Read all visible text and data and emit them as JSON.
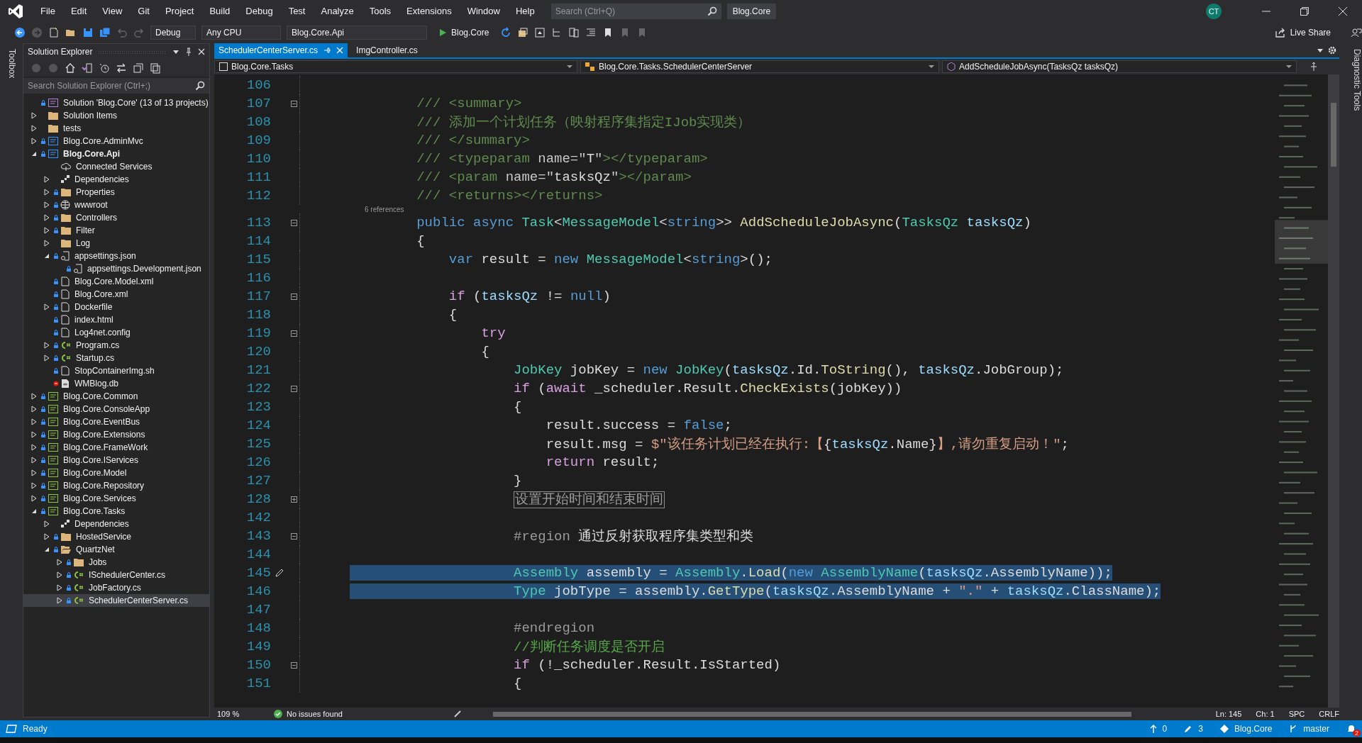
{
  "menu": [
    "File",
    "Edit",
    "View",
    "Git",
    "Project",
    "Build",
    "Debug",
    "Test",
    "Analyze",
    "Tools",
    "Extensions",
    "Window",
    "Help"
  ],
  "search": {
    "placeholder": "Search (Ctrl+Q)"
  },
  "solution_title": "Blog.Core",
  "avatar": "CT",
  "toolbar": {
    "configuration": "Debug",
    "platform": "Any CPU",
    "startup_project": "Blog.Core.Api",
    "run_target": "Blog.Core",
    "live_share": "Live Share"
  },
  "left_strip": "Toolbox",
  "right_strip": "Diagnostic Tools",
  "solution_explorer": {
    "title": "Solution Explorer",
    "search": {
      "placeholder": "Search Solution Explorer (Ctrl+;)"
    },
    "tree": [
      {
        "label": "Solution 'Blog.Core' (13 of 13 projects)",
        "kind": "solution",
        "locked": true,
        "startup": false,
        "selected": false,
        "children": [
          {
            "label": "Solution Items",
            "kind": "folder",
            "expanded": false,
            "locked": false,
            "startup": false,
            "selected": false
          },
          {
            "label": "tests",
            "kind": "folder",
            "expanded": false,
            "locked": false,
            "startup": false,
            "selected": false
          },
          {
            "label": "Blog.Core.AdminMvc",
            "kind": "webproj",
            "expanded": false,
            "locked": true,
            "startup": false,
            "selected": false
          },
          {
            "label": "Blog.Core.Api",
            "kind": "webproj",
            "expanded": true,
            "locked": true,
            "startup": true,
            "selected": false,
            "children": [
              {
                "label": "Connected Services",
                "kind": "cloud",
                "locked": false,
                "startup": false,
                "selected": false
              },
              {
                "label": "Dependencies",
                "kind": "deps",
                "expanded": false,
                "locked": false,
                "startup": false,
                "selected": false
              },
              {
                "label": "Properties",
                "kind": "folder",
                "expanded": false,
                "locked": true,
                "startup": false,
                "selected": false
              },
              {
                "label": "wwwroot",
                "kind": "globe",
                "expanded": false,
                "locked": true,
                "startup": false,
                "selected": false
              },
              {
                "label": "Controllers",
                "kind": "folder",
                "expanded": false,
                "locked": true,
                "startup": false,
                "selected": false
              },
              {
                "label": "Filter",
                "kind": "folder",
                "expanded": false,
                "locked": true,
                "startup": false,
                "selected": false
              },
              {
                "label": "Log",
                "kind": "folder",
                "expanded": false,
                "locked": false,
                "startup": false,
                "selected": false
              },
              {
                "label": "appsettings.json",
                "kind": "json",
                "expanded": true,
                "locked": true,
                "startup": false,
                "selected": false,
                "children": [
                  {
                    "label": "appsettings.Development.json",
                    "kind": "json",
                    "locked": true,
                    "startup": false,
                    "selected": false
                  }
                ]
              },
              {
                "label": "Blog.Core.Model.xml",
                "kind": "file",
                "locked": true,
                "startup": false,
                "selected": false
              },
              {
                "label": "Blog.Core.xml",
                "kind": "file",
                "locked": true,
                "startup": false,
                "selected": false
              },
              {
                "label": "Dockerfile",
                "kind": "file",
                "expanded": false,
                "locked": true,
                "startup": false,
                "selected": false
              },
              {
                "label": "index.html",
                "kind": "file",
                "locked": true,
                "startup": false,
                "selected": false
              },
              {
                "label": "Log4net.config",
                "kind": "file",
                "locked": true,
                "startup": false,
                "selected": false
              },
              {
                "label": "Program.cs",
                "kind": "cs",
                "expanded": false,
                "locked": true,
                "startup": false,
                "selected": false
              },
              {
                "label": "Startup.cs",
                "kind": "cs",
                "expanded": false,
                "locked": true,
                "startup": false,
                "selected": false
              },
              {
                "label": "StopContainerImg.sh",
                "kind": "file",
                "locked": true,
                "startup": false,
                "selected": false
              },
              {
                "label": "WMBlog.db",
                "kind": "db",
                "locked": false,
                "startup": false,
                "selected": false
              }
            ]
          },
          {
            "label": "Blog.Core.Common",
            "kind": "csproj",
            "expanded": false,
            "locked": true,
            "startup": false,
            "selected": false
          },
          {
            "label": "Blog.Core.ConsoleApp",
            "kind": "csproj",
            "expanded": false,
            "locked": true,
            "startup": false,
            "selected": false
          },
          {
            "label": "Blog.Core.EventBus",
            "kind": "csproj",
            "expanded": false,
            "locked": true,
            "startup": false,
            "selected": false
          },
          {
            "label": "Blog.Core.Extensions",
            "kind": "csproj",
            "expanded": false,
            "locked": true,
            "startup": false,
            "selected": false
          },
          {
            "label": "Blog.Core.FrameWork",
            "kind": "csproj",
            "expanded": false,
            "locked": true,
            "startup": false,
            "selected": false
          },
          {
            "label": "Blog.Core.IServices",
            "kind": "csproj",
            "expanded": false,
            "locked": true,
            "startup": false,
            "selected": false
          },
          {
            "label": "Blog.Core.Model",
            "kind": "csproj",
            "expanded": false,
            "locked": true,
            "startup": false,
            "selected": false
          },
          {
            "label": "Blog.Core.Repository",
            "kind": "csproj",
            "expanded": false,
            "locked": true,
            "startup": false,
            "selected": false
          },
          {
            "label": "Blog.Core.Services",
            "kind": "csproj",
            "expanded": false,
            "locked": true,
            "startup": false,
            "selected": false
          },
          {
            "label": "Blog.Core.Tasks",
            "kind": "csproj",
            "expanded": true,
            "locked": true,
            "startup": false,
            "selected": false,
            "children": [
              {
                "label": "Dependencies",
                "kind": "deps",
                "expanded": false,
                "locked": false,
                "startup": false,
                "selected": false
              },
              {
                "label": "HostedService",
                "kind": "folder",
                "expanded": false,
                "locked": true,
                "startup": false,
                "selected": false
              },
              {
                "label": "QuartzNet",
                "kind": "folder",
                "expanded": true,
                "locked": true,
                "startup": false,
                "selected": false,
                "children": [
                  {
                    "label": "Jobs",
                    "kind": "folder",
                    "expanded": false,
                    "locked": true,
                    "startup": false,
                    "selected": false
                  },
                  {
                    "label": "ISchedulerCenter.cs",
                    "kind": "cs",
                    "expanded": false,
                    "locked": true,
                    "startup": false,
                    "selected": false
                  },
                  {
                    "label": "JobFactory.cs",
                    "kind": "cs",
                    "expanded": false,
                    "locked": true,
                    "startup": false,
                    "selected": false
                  },
                  {
                    "label": "SchedulerCenterServer.cs",
                    "kind": "cs",
                    "expanded": false,
                    "locked": true,
                    "startup": false,
                    "selected": true
                  }
                ]
              }
            ]
          }
        ]
      }
    ]
  },
  "tabs": [
    {
      "label": "SchedulerCenterServer.cs",
      "selected": true
    },
    {
      "label": "ImgController.cs",
      "selected": false
    }
  ],
  "navigation": {
    "project": "Blog.Core.Tasks",
    "type": "Blog.Core.Tasks.SchedulerCenterServer",
    "member": "AddScheduleJobAsync(TasksQz tasksQz)"
  },
  "code": [
    {
      "number": "106",
      "selected": false
    },
    {
      "number": "107",
      "expanded": true,
      "selected": false,
      "tokens": [
        {
          "kind": "doc",
          "text": "        /// <summary>"
        }
      ]
    },
    {
      "number": "108",
      "selected": false,
      "tokens": [
        {
          "kind": "doc",
          "text": "        /// 添加一个计划任务（映射程序集指定IJob实现类）"
        }
      ]
    },
    {
      "number": "109",
      "selected": false,
      "tokens": [
        {
          "kind": "doc",
          "text": "        /// </summary>"
        }
      ]
    },
    {
      "number": "110",
      "selected": false,
      "tokens": [
        {
          "kind": "doc",
          "text": "        /// <typeparam "
        },
        {
          "kind": "docattr",
          "text": "name=\""
        },
        {
          "kind": "plain",
          "text": "T"
        },
        {
          "kind": "docattr",
          "text": "\""
        },
        {
          "kind": "doc",
          "text": "></typeparam>"
        }
      ]
    },
    {
      "number": "111",
      "selected": false,
      "tokens": [
        {
          "kind": "doc",
          "text": "        /// <param "
        },
        {
          "kind": "docattr",
          "text": "name=\""
        },
        {
          "kind": "plain",
          "text": "tasksQz"
        },
        {
          "kind": "docattr",
          "text": "\""
        },
        {
          "kind": "doc",
          "text": "></param>"
        }
      ]
    },
    {
      "number": "112",
      "selected": false,
      "tokens": [
        {
          "kind": "doc",
          "text": "        /// <returns></returns>"
        }
      ]
    },
    {
      "number": "113",
      "expanded": true,
      "selected": false,
      "codelens": "6 references",
      "tokens": [
        {
          "kind": "keyword",
          "text": "        public async "
        },
        {
          "kind": "type",
          "text": "Task"
        },
        {
          "kind": "plain",
          "text": "<"
        },
        {
          "kind": "type",
          "text": "MessageModel"
        },
        {
          "kind": "plain",
          "text": "<"
        },
        {
          "kind": "keyword",
          "text": "string"
        },
        {
          "kind": "plain",
          "text": ">> "
        },
        {
          "kind": "method",
          "text": "AddScheduleJobAsync"
        },
        {
          "kind": "plain",
          "text": "("
        },
        {
          "kind": "type",
          "text": "TasksQz"
        },
        {
          "kind": "param",
          "text": " tasksQz"
        },
        {
          "kind": "plain",
          "text": ")"
        }
      ]
    },
    {
      "number": "114",
      "selected": false,
      "tokens": [
        {
          "kind": "plain",
          "text": "        {"
        }
      ]
    },
    {
      "number": "115",
      "selected": false,
      "tokens": [
        {
          "kind": "keyword",
          "text": "            var "
        },
        {
          "kind": "plain",
          "text": "result = "
        },
        {
          "kind": "keyword",
          "text": "new "
        },
        {
          "kind": "type",
          "text": "MessageModel"
        },
        {
          "kind": "plain",
          "text": "<"
        },
        {
          "kind": "keyword",
          "text": "string"
        },
        {
          "kind": "plain",
          "text": ">();"
        }
      ]
    },
    {
      "number": "116",
      "selected": false
    },
    {
      "number": "117",
      "expanded": true,
      "selected": false,
      "tokens": [
        {
          "kind": "control",
          "text": "            if "
        },
        {
          "kind": "plain",
          "text": "("
        },
        {
          "kind": "param",
          "text": "tasksQz"
        },
        {
          "kind": "plain",
          "text": " != "
        },
        {
          "kind": "keyword",
          "text": "null"
        },
        {
          "kind": "plain",
          "text": ")"
        }
      ]
    },
    {
      "number": "118",
      "selected": false,
      "tokens": [
        {
          "kind": "plain",
          "text": "            {"
        }
      ]
    },
    {
      "number": "119",
      "expanded": true,
      "selected": false,
      "tokens": [
        {
          "kind": "control",
          "text": "                try"
        }
      ]
    },
    {
      "number": "120",
      "selected": false,
      "tokens": [
        {
          "kind": "plain",
          "text": "                {"
        }
      ]
    },
    {
      "number": "121",
      "selected": false,
      "tokens": [
        {
          "kind": "type",
          "text": "                    JobKey "
        },
        {
          "kind": "plain",
          "text": "jobKey = "
        },
        {
          "kind": "keyword",
          "text": "new "
        },
        {
          "kind": "type",
          "text": "JobKey"
        },
        {
          "kind": "plain",
          "text": "("
        },
        {
          "kind": "param",
          "text": "tasksQz"
        },
        {
          "kind": "plain",
          "text": ".Id."
        },
        {
          "kind": "method",
          "text": "ToString"
        },
        {
          "kind": "plain",
          "text": "(), "
        },
        {
          "kind": "param",
          "text": "tasksQz"
        },
        {
          "kind": "plain",
          "text": ".JobGroup);"
        }
      ]
    },
    {
      "number": "122",
      "expanded": true,
      "selected": false,
      "tokens": [
        {
          "kind": "control",
          "text": "                    if "
        },
        {
          "kind": "plain",
          "text": "("
        },
        {
          "kind": "control",
          "text": "await "
        },
        {
          "kind": "plain",
          "text": "_scheduler.Result."
        },
        {
          "kind": "method",
          "text": "CheckExists"
        },
        {
          "kind": "plain",
          "text": "(jobKey))"
        }
      ]
    },
    {
      "number": "123",
      "selected": false,
      "tokens": [
        {
          "kind": "plain",
          "text": "                    {"
        }
      ]
    },
    {
      "number": "124",
      "selected": false,
      "tokens": [
        {
          "kind": "plain",
          "text": "                        result.success = "
        },
        {
          "kind": "keyword",
          "text": "false"
        },
        {
          "kind": "plain",
          "text": ";"
        }
      ]
    },
    {
      "number": "125",
      "selected": false,
      "tokens": [
        {
          "kind": "plain",
          "text": "                        result.msg = "
        },
        {
          "kind": "string",
          "text": "$\"该任务计划已经在执行:【"
        },
        {
          "kind": "plain",
          "text": "{"
        },
        {
          "kind": "param",
          "text": "tasksQz"
        },
        {
          "kind": "plain",
          "text": ".Name}"
        },
        {
          "kind": "string",
          "text": "】,请勿重复启动！\""
        },
        {
          "kind": "plain",
          "text": ";"
        }
      ]
    },
    {
      "number": "126",
      "selected": false,
      "tokens": [
        {
          "kind": "control",
          "text": "                        return "
        },
        {
          "kind": "plain",
          "text": "result;"
        }
      ]
    },
    {
      "number": "127",
      "selected": false,
      "tokens": [
        {
          "kind": "plain",
          "text": "                    }"
        }
      ]
    },
    {
      "number": "128",
      "expanded": false,
      "selected": false,
      "tokens": [
        {
          "kind": "collapsed",
          "text": "设置开始时间和结束时间"
        }
      ]
    },
    {
      "number": "142",
      "selected": false
    },
    {
      "number": "143",
      "expanded": true,
      "selected": false,
      "tokens": [
        {
          "kind": "region",
          "text": "                    #region "
        },
        {
          "kind": "plain",
          "text": "通过反射获取程序集类型和类"
        }
      ]
    },
    {
      "number": "144",
      "selected": false
    },
    {
      "number": "145",
      "selected": true,
      "quick_action": true,
      "tokens": [
        {
          "kind": "type",
          "text": "                    Assembly "
        },
        {
          "kind": "plain",
          "text": "assembly = "
        },
        {
          "kind": "type",
          "text": "Assembly"
        },
        {
          "kind": "plain",
          "text": "."
        },
        {
          "kind": "method",
          "text": "Load"
        },
        {
          "kind": "plain",
          "text": "("
        },
        {
          "kind": "keyword",
          "text": "new "
        },
        {
          "kind": "type",
          "text": "AssemblyName"
        },
        {
          "kind": "plain",
          "text": "("
        },
        {
          "kind": "param",
          "text": "tasksQz"
        },
        {
          "kind": "plain",
          "text": ".AssemblyName));"
        }
      ]
    },
    {
      "number": "146",
      "selected": true,
      "tokens": [
        {
          "kind": "type",
          "text": "                    Type "
        },
        {
          "kind": "plain",
          "text": "jobType = assembly."
        },
        {
          "kind": "method",
          "text": "GetType"
        },
        {
          "kind": "plain",
          "text": "("
        },
        {
          "kind": "param",
          "text": "tasksQz"
        },
        {
          "kind": "plain",
          "text": ".AssemblyName + "
        },
        {
          "kind": "string",
          "text": "\".\""
        },
        {
          "kind": "plain",
          "text": " + "
        },
        {
          "kind": "param",
          "text": "tasksQz"
        },
        {
          "kind": "plain",
          "text": ".ClassName);"
        }
      ]
    },
    {
      "number": "147",
      "selected": false
    },
    {
      "number": "148",
      "selected": false,
      "tokens": [
        {
          "kind": "region",
          "text": "                    #endregion"
        }
      ]
    },
    {
      "number": "149",
      "selected": false,
      "tokens": [
        {
          "kind": "comment",
          "text": "                    //判断任务调度是否开启"
        }
      ]
    },
    {
      "number": "150",
      "expanded": true,
      "selected": false,
      "tokens": [
        {
          "kind": "control",
          "text": "                    if "
        },
        {
          "kind": "plain",
          "text": "(!_scheduler.Result.IsStarted)"
        }
      ]
    },
    {
      "number": "151",
      "selected": false,
      "tokens": [
        {
          "kind": "plain",
          "text": "                    {"
        }
      ]
    }
  ],
  "editor_status": {
    "zoom": "109 %",
    "issues": "No issues found",
    "line": "Ln: 145",
    "column": "Ch: 1",
    "whitespace": "SPC",
    "line_endings": "CRLF"
  },
  "status_bar": {
    "text": "Ready",
    "push_count": "0",
    "changes_count": "3",
    "repository": "Blog.Core",
    "branch": "master",
    "notifications": "2"
  }
}
